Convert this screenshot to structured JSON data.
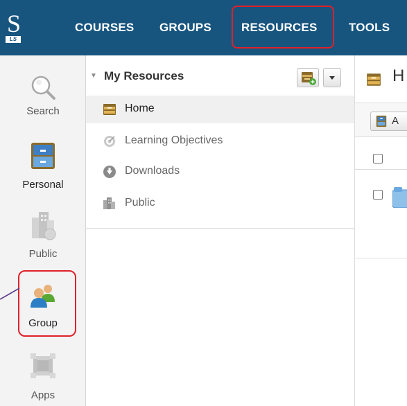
{
  "logo": {
    "text": "S",
    "sub": "LS"
  },
  "nav": {
    "courses": "COURSES",
    "groups": "GROUPS",
    "resources": "RESOURCES",
    "tools": "TOOLS"
  },
  "rail": {
    "search": "Search",
    "personal": "Personal",
    "public": "Public",
    "group": "Group",
    "apps": "Apps"
  },
  "tree": {
    "title": "My Resources",
    "items": [
      {
        "label": "Home",
        "icon": "archive-box-icon"
      },
      {
        "label": "Learning Objectives",
        "icon": "target-icon"
      },
      {
        "label": "Downloads",
        "icon": "download-circle-icon"
      },
      {
        "label": "Public",
        "icon": "building-icon"
      }
    ]
  },
  "content": {
    "title": "H",
    "toolbar_label": "A"
  },
  "colors": {
    "nav_bg": "#17557f",
    "highlight": "#e0202a"
  }
}
